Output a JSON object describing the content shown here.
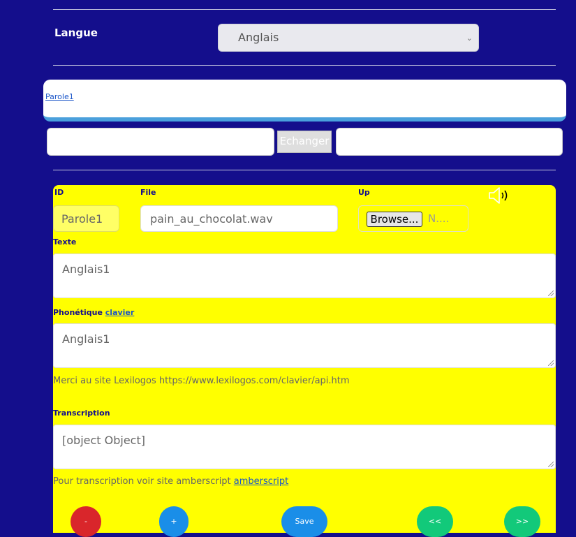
{
  "language": {
    "label": "Langue",
    "selected": "Anglais"
  },
  "tab": {
    "link": "Parole1"
  },
  "swap": {
    "left_value": "",
    "button": "Echanger",
    "right_value": ""
  },
  "form": {
    "id_label": "ID",
    "id_value": "Parole1",
    "file_label": "File",
    "file_value": "pain_au_chocolat.wav",
    "up_label": "Up",
    "browse_label": "Browse...",
    "no_file_text": "N....",
    "texte_label": "Texte",
    "texte_value": "Anglais1",
    "phonetique_label": "Phonétique",
    "phonetique_link": "clavier",
    "phonetique_value": "Anglais1",
    "lexilogos_note": "Merci au site Lexilogos https://www.lexilogos.com/clavier/api.htm",
    "transcription_label": "Transcription",
    "transcription_value": "[object Object]",
    "amberscript_note": "Pour transcription voir site amberscript",
    "amberscript_link": "amberscript"
  },
  "actions": {
    "minus": "-",
    "plus": "+",
    "save": "Save",
    "prev": "<<",
    "next": ">>"
  },
  "colors": {
    "background": "#140e8c",
    "card": "#ffff00",
    "minus": "#d9262b",
    "plus": "#1a8ee8",
    "save": "#1a8ee8",
    "nav": "#12c97a"
  }
}
